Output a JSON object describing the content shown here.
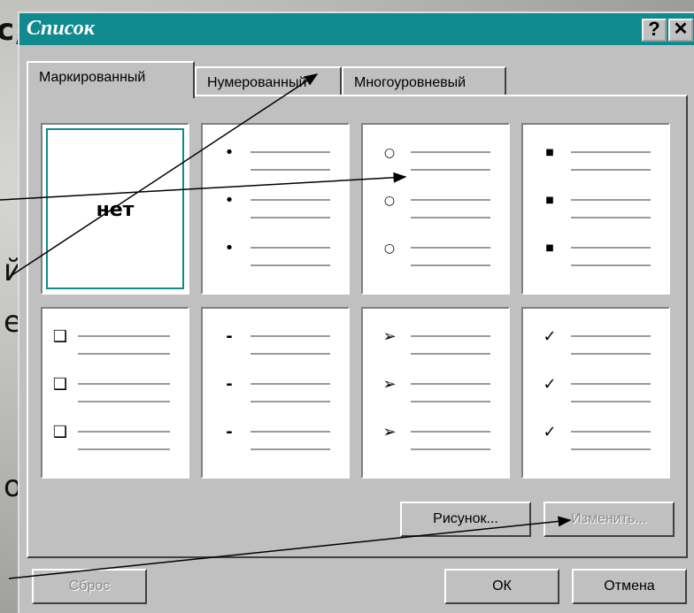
{
  "background_fragments": [
    "с;",
    "й",
    "е",
    "о"
  ],
  "dialog": {
    "title": "Список",
    "help_button": "?",
    "close_button": "✕",
    "tabs": [
      {
        "label": "Маркированный",
        "active": true
      },
      {
        "label": "Нумерованный",
        "active": false
      },
      {
        "label": "Многоуровневый",
        "active": false
      }
    ],
    "none_label": "нет",
    "styles": [
      {
        "marker": "•"
      },
      {
        "marker": "○"
      },
      {
        "marker": "■"
      },
      {
        "marker": "❑"
      },
      {
        "marker": "-"
      },
      {
        "marker": "➢"
      },
      {
        "marker": "✓"
      }
    ],
    "picture_button": "Рисунок...",
    "change_button": "Изменить...",
    "reset_button": "Сброс",
    "ok_button": "ОК",
    "cancel_button": "Отмена"
  },
  "colors": {
    "titlebar": "#0f8a8e",
    "dialog_face": "#c0c0c0",
    "selection_frame": "#0f8a8e"
  }
}
